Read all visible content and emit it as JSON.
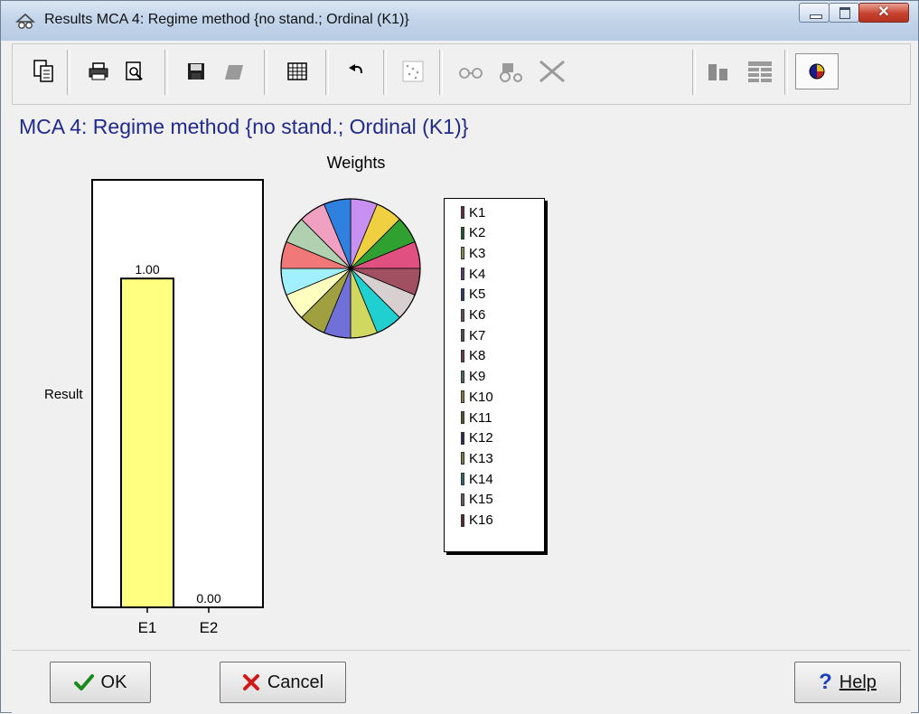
{
  "window": {
    "title": "Results MCA 4: Regime method {no stand.; Ordinal (K1)}"
  },
  "toolbar": {
    "buttons": [
      {
        "name": "copy-icon"
      },
      {
        "name": "print-icon"
      },
      {
        "name": "print-preview-icon"
      },
      {
        "name": "save-icon"
      },
      {
        "name": "export-icon"
      },
      {
        "name": "table-icon"
      },
      {
        "name": "undo-icon"
      },
      {
        "name": "scatter-icon"
      },
      {
        "name": "glasses-icon"
      },
      {
        "name": "tractor-icon"
      },
      {
        "name": "cross-icon"
      },
      {
        "name": "bar-view-icon"
      },
      {
        "name": "list-view-icon"
      },
      {
        "name": "pie-view-icon"
      }
    ]
  },
  "heading": "MCA 4: Regime method {no stand.; Ordinal (K1)}",
  "chart_data": [
    {
      "type": "bar",
      "categories": [
        "E1",
        "E2"
      ],
      "values": [
        1.0,
        0.0
      ],
      "value_labels": [
        "1.00",
        "0.00"
      ],
      "ylabel": "Result",
      "ylim": [
        0,
        1.3
      ],
      "bar_color": "#ffff80"
    },
    {
      "type": "pie",
      "title": "Weights",
      "labels": [
        "K1",
        "K2",
        "K3",
        "K4",
        "K5",
        "K6",
        "K7",
        "K8",
        "K9",
        "K10",
        "K11",
        "K12",
        "K13",
        "K14",
        "K15",
        "K16"
      ],
      "values": [
        1,
        1,
        1,
        1,
        1,
        1,
        1,
        1,
        1,
        1,
        1,
        1,
        1,
        1,
        1,
        1
      ],
      "colors": [
        "#c890f0",
        "#f0d040",
        "#30a030",
        "#e05080",
        "#a05060",
        "#d8d0d0",
        "#20d0d0",
        "#d0d860",
        "#7070d8",
        "#a0a040",
        "#ffffc0",
        "#a0f0ff",
        "#f07878",
        "#b0d0b0",
        "#f0a0c0",
        "#3080e0"
      ],
      "legend_colors": [
        "#6a2a3a",
        "#1c5a2a",
        "#8a8a4a",
        "#5a3a7a",
        "#2a3a7a",
        "#6a4a5a",
        "#5a4a4a",
        "#6a3a4a",
        "#4a6a6a",
        "#8a7a3a",
        "#4a5a2a",
        "#2a2a6a",
        "#7a7a3a",
        "#2a6a6a",
        "#6a5a5a",
        "#5a2a2a"
      ]
    }
  ],
  "footer": {
    "ok_label": "OK",
    "cancel_label": "Cancel",
    "help_label": "Help"
  }
}
